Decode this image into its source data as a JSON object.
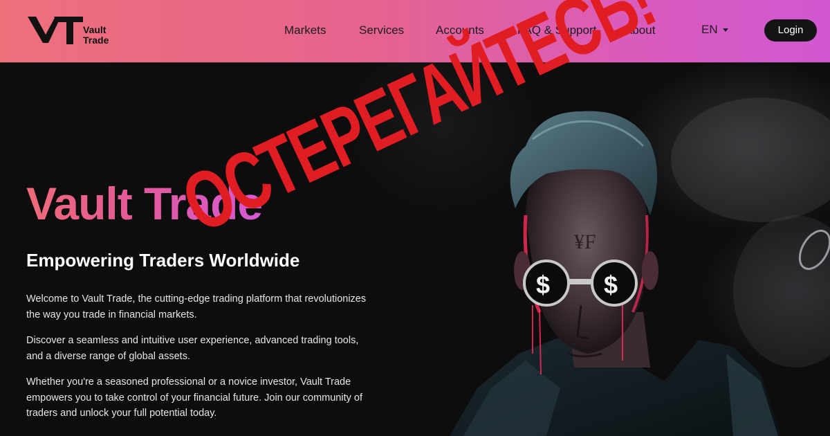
{
  "brand": {
    "name_line1": "Vault",
    "name_line2": "Trade"
  },
  "nav": {
    "items": [
      {
        "label": "Markets"
      },
      {
        "label": "Services"
      },
      {
        "label": "Accounts"
      },
      {
        "label": "FAQ & Support"
      },
      {
        "label": "About"
      }
    ],
    "language": "EN",
    "login_label": "Login"
  },
  "hero": {
    "title": "Vault Trade",
    "subtitle": "Empowering Traders Worldwide",
    "paragraphs": [
      "Welcome to Vault Trade, the cutting-edge trading platform that revolutionizes the way you trade in financial markets.",
      "Discover a seamless and intuitive user experience, advanced trading tools, and a diverse range of global assets.",
      "Whether you're a seasoned professional or a novice investor, Vault Trade empowers you to take control of your financial future. Join our community of traders and unlock your full potential today."
    ]
  },
  "overlay": {
    "warning_text": "ОСТЕРЕГАЙТЕСЬ!"
  },
  "colors": {
    "nav_gradient_start": "#ee707b",
    "nav_gradient_end": "#d158d2",
    "warning_red": "#e11d24",
    "login_button": "#141414"
  }
}
